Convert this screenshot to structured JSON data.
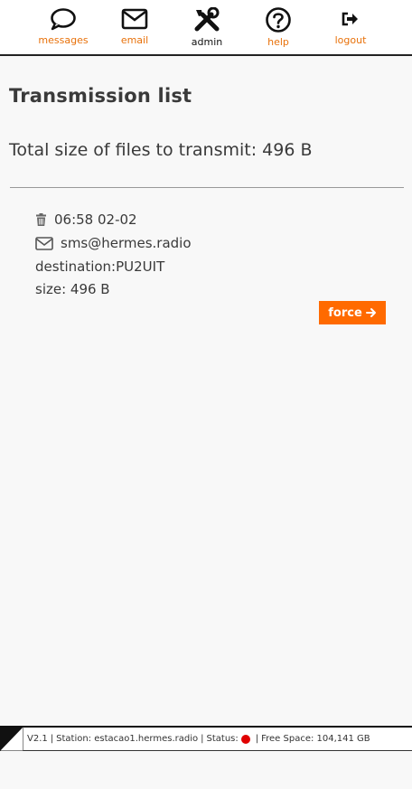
{
  "nav": {
    "items": [
      {
        "label": "messages",
        "icon": "comment-icon"
      },
      {
        "label": "email",
        "icon": "envelope-icon"
      },
      {
        "label": "admin",
        "icon": "tools-icon"
      },
      {
        "label": "help",
        "icon": "question-circle-icon"
      },
      {
        "label": "logout",
        "icon": "sign-out-icon"
      }
    ]
  },
  "page": {
    "title": "Transmission list",
    "total_label": "Total size of files to transmit: 496 B"
  },
  "entry": {
    "time": "06:58 02-02",
    "email": "sms@hermes.radio",
    "destination": "destination:PU2UIT",
    "size": "size: 496 B",
    "force_label": "force"
  },
  "status": {
    "version": "V2.1",
    "station": "Station: estacao1.hermes.radio",
    "status_label": "Status:",
    "status_color": "#e00000",
    "free_space": "Free Space: 104,141 GB"
  },
  "colors": {
    "accent": "#ff6a00",
    "nav_label": "#e8710a"
  }
}
